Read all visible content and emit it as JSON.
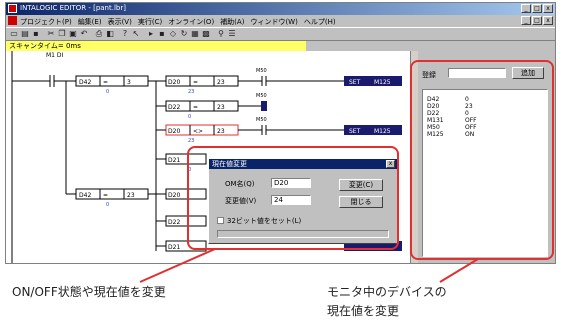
{
  "window": {
    "title": "INTALOGIC EDITOR - [pant.lbr]",
    "min": "_",
    "max": "□",
    "close": "x"
  },
  "menus": [
    "プロジェクト(P)",
    "編集(E)",
    "表示(V)",
    "実行(C)",
    "オンライン(O)",
    "補助(A)",
    "ウィンドウ(W)",
    "ヘルプ(H)"
  ],
  "scanbar": "スキャンタイム= 0ms",
  "ladder": {
    "start_contact": "M1 DI",
    "rows": [
      {
        "cmp": "=",
        "dev1": "D42",
        "val1": "3",
        "dev2": "D20",
        "val2": "23",
        "contact": "M50",
        "coil": "SET",
        "coil_dev": "M125"
      },
      {
        "dev2": "D22",
        "op2": "=",
        "val2": "23",
        "contact": "M50"
      },
      {
        "dev2": "D20",
        "op2": "<>",
        "val2": "23",
        "contact": "M50",
        "coil": "SET",
        "coil_dev": "M125"
      },
      {
        "dev2": "D21"
      },
      {
        "cmp": "=",
        "dev1": "D42",
        "val1": "23",
        "dev2": "D20"
      },
      {
        "dev2": "D22"
      },
      {
        "dev2": "D21"
      }
    ]
  },
  "dialog": {
    "title": "現在値変更",
    "name_label": "OM名(Q)",
    "name_value": "D20",
    "val_label": "変更値(V)",
    "val_value": "24",
    "ok": "変更(C)",
    "close": "閉じる",
    "checkbox": "32ビット値をセット(L)"
  },
  "monitor": {
    "register_label": "登録",
    "add_button": "追加",
    "items": [
      {
        "dev": "D42",
        "val": "0"
      },
      {
        "dev": "D20",
        "val": "23"
      },
      {
        "dev": "D22",
        "val": "0"
      },
      {
        "dev": "M131",
        "val": "OFF"
      },
      {
        "dev": "M50",
        "val": "OFF"
      },
      {
        "dev": "M125",
        "val": "ON"
      }
    ]
  },
  "captions": {
    "left": "ON/OFF状態や現在値を変更",
    "right_line1": "モニタ中のデバイスの",
    "right_line2": "現在値を変更"
  },
  "colors": {
    "highlight": "#e03030",
    "coil_box": "#1a1a6e",
    "title_bar": "#0a246a",
    "scanbar": "#ffff66"
  }
}
